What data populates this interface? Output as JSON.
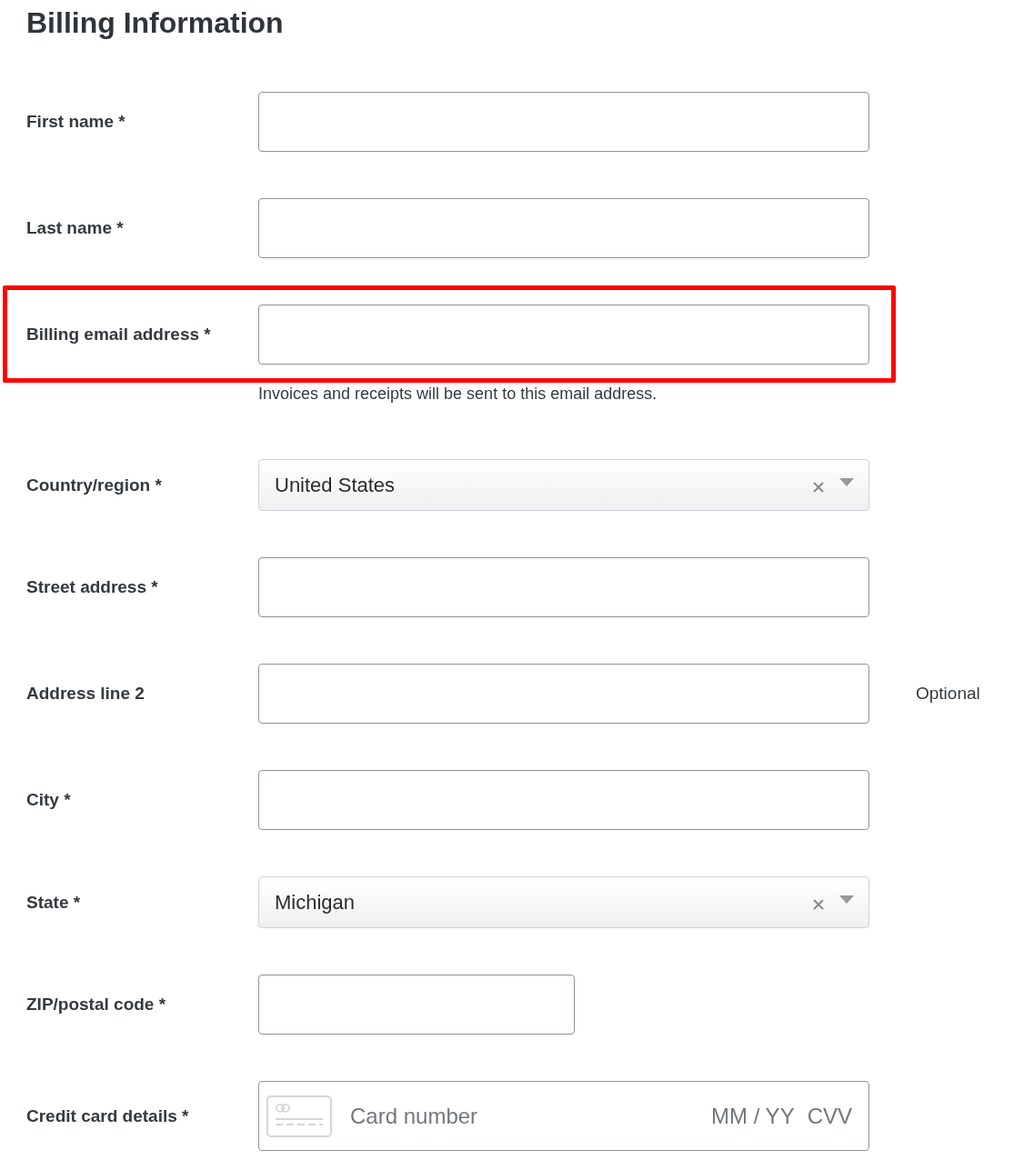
{
  "title": "Billing Information",
  "fields": [
    {
      "kind": "text",
      "label": "First name *",
      "highlighted": false
    },
    {
      "kind": "text",
      "label": "Last name *",
      "highlighted": false
    },
    {
      "kind": "text",
      "label": "Billing email address *",
      "highlighted": true,
      "hint": "Invoices and receipts will be sent to this email address."
    },
    {
      "kind": "select",
      "label": "Country/region *",
      "highlighted": false,
      "value": "United States"
    },
    {
      "kind": "text",
      "label": "Street address *",
      "highlighted": false
    },
    {
      "kind": "text",
      "label": "Address line 2",
      "highlighted": false,
      "note": "Optional"
    },
    {
      "kind": "text",
      "label": "City *",
      "highlighted": false
    },
    {
      "kind": "select",
      "label": "State *",
      "highlighted": false,
      "value": "Michigan"
    },
    {
      "kind": "short",
      "label": "ZIP/postal code *",
      "highlighted": false
    },
    {
      "kind": "card",
      "label": "Credit card details *",
      "highlighted": false,
      "card_number_placeholder": "Card number",
      "expiry_placeholder": "MM / YY",
      "cvv_placeholder": "CVV"
    }
  ]
}
